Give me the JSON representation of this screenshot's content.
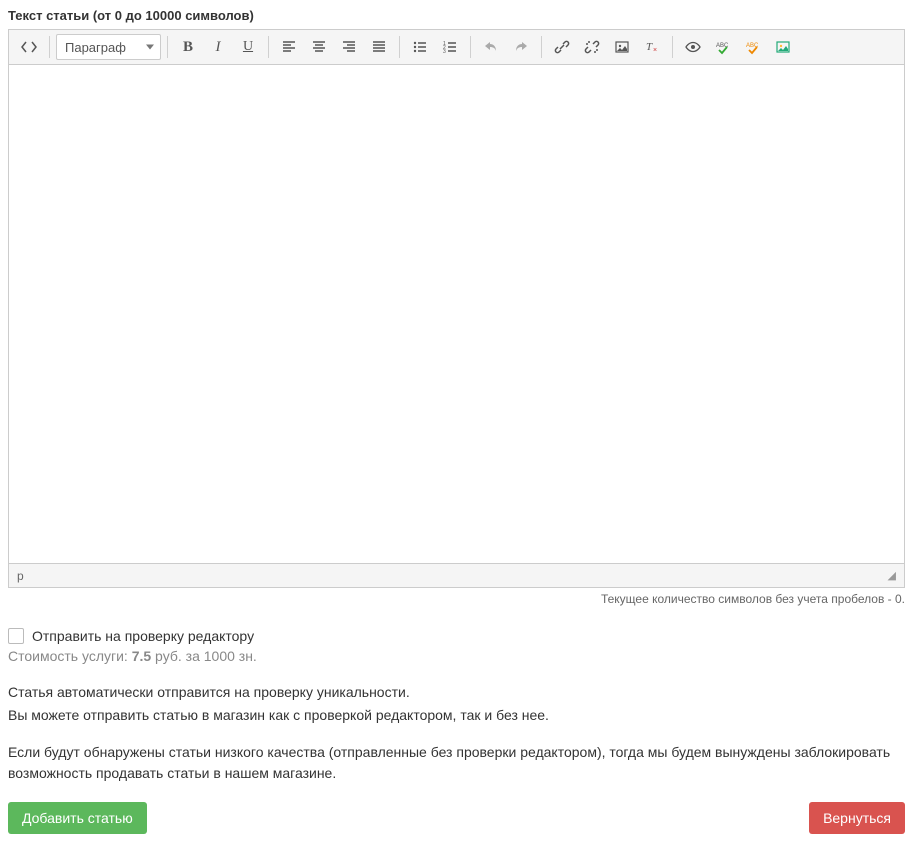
{
  "field_label": "Текст статьи (от 0 до 10000 символов)",
  "toolbar": {
    "format_label": "Параграф"
  },
  "statusbar": {
    "path": "p"
  },
  "char_count": "Текущее количество символов без учета пробелов - 0.",
  "checkbox": {
    "label": "Отправить на проверку редактору"
  },
  "cost": {
    "prefix": "Стоимость услуги: ",
    "value": "7.5",
    "suffix": " руб. за 1000 зн."
  },
  "info": {
    "line1": "Статья автоматически отправится на проверку уникальности.",
    "line2": "Вы можете отправить статью в магазин как с проверкой редактором, так и без нее.",
    "warn": "Если будут обнаружены статьи низкого качества (отправленные без проверки редактором), тогда мы будем вынуждены заблокировать возможность продавать статьи в нашем магазине."
  },
  "buttons": {
    "add": "Добавить статью",
    "back": "Вернуться"
  }
}
